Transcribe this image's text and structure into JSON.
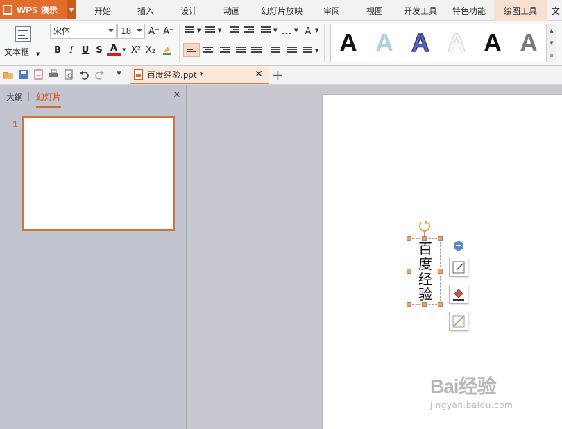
{
  "app": {
    "name": "WPS 演示"
  },
  "menu": {
    "tabs": [
      {
        "label": "开始"
      },
      {
        "label": "插入"
      },
      {
        "label": "设计"
      },
      {
        "label": "动画"
      },
      {
        "label": "幻灯片放映"
      },
      {
        "label": "审阅"
      },
      {
        "label": "视图"
      },
      {
        "label": "开发工具"
      },
      {
        "label": "特色功能"
      },
      {
        "label": "绘图工具"
      },
      {
        "label": "文"
      }
    ],
    "active_tab": "绘图工具"
  },
  "ribbon": {
    "textbox_label": "文本框",
    "font_name": "宋体",
    "font_size": "18",
    "format_buttons": {
      "bold": "B",
      "italic": "I",
      "underline": "U",
      "strike": "S",
      "font_color": "A",
      "superscript": "X²",
      "subscript": "X₂",
      "grow": "A⁺",
      "shrink": "A⁻"
    },
    "style_letter": "A",
    "style_colors": [
      "#111111",
      "#a9d3de",
      "#4a55a8",
      "#e6e6e6",
      "#111111",
      "#7a7a7a"
    ]
  },
  "quick_access": {
    "document_tab": "百度经验.ppt *"
  },
  "left_panel": {
    "tabs": [
      {
        "label": "大纲"
      },
      {
        "label": "幻灯片"
      }
    ],
    "active_tab": "幻灯片",
    "slide_number": "1"
  },
  "slide": {
    "textbox_text": "百度经验"
  },
  "watermark": {
    "brand": "Bai经验",
    "url": "jingyan.baidu.com"
  },
  "colors": {
    "accent": "#e06d2b",
    "selection": "#f6d8c4"
  }
}
